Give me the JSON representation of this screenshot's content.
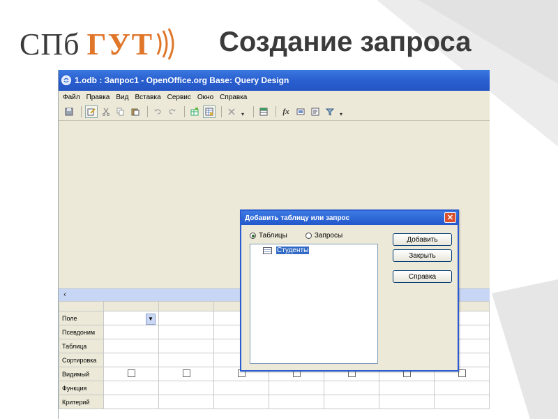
{
  "slide": {
    "logo_spb": "СПб",
    "logo_gut": "ГУТ",
    "title": "Создание запроса"
  },
  "window": {
    "title": "1.odb : Запрос1 - OpenOffice.org Base: Query Design"
  },
  "menu": [
    "Файл",
    "Правка",
    "Вид",
    "Вставка",
    "Сервис",
    "Окно",
    "Справка"
  ],
  "grid": {
    "rows": [
      "Поле",
      "Псевдоним",
      "Таблица",
      "Сортировка",
      "Видимый",
      "Функция",
      "Критерий"
    ],
    "columns": 7
  },
  "dialog": {
    "title": "Добавить таблицу или запрос",
    "close_label": "✕",
    "radio_tables": "Таблицы",
    "radio_queries": "Запросы",
    "list_items": [
      "Студенты"
    ],
    "btn_add": "Добавить",
    "btn_close": "Закрыть",
    "btn_help": "Справка"
  },
  "colors": {
    "brand_orange": "#e0762a",
    "xp_blue": "#2a5fcf",
    "selection": "#316ac5"
  }
}
